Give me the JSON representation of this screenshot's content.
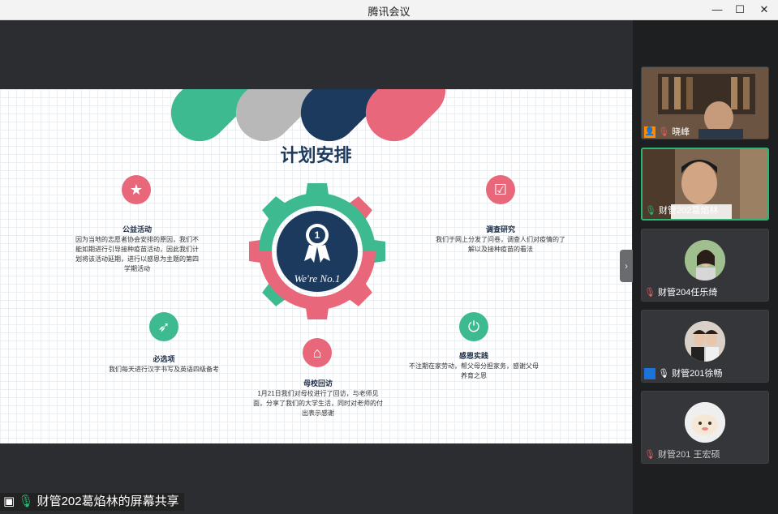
{
  "window": {
    "title": "腾讯会议",
    "min": "—",
    "max": "☐",
    "close": "✕"
  },
  "slide": {
    "title": "计划安排",
    "badge_number": "1",
    "badge_text": "We're No.1",
    "items": [
      {
        "title": "公益活动",
        "desc": "因为当地的志愿者协会安排的原因，我们不能如期进行引导接种疫苗活动，因此我们计划将该活动延期，进行以感恩为主题的第四学期活动",
        "icon": "star-icon"
      },
      {
        "title": "调查研究",
        "desc": "我们于网上分发了问卷，调查人们对疫情的了解以及接种疫苗的看法",
        "icon": "check-icon"
      },
      {
        "title": "必选项",
        "desc": "我们每天进行汉字书写及英语四级备考",
        "icon": "rocket-icon"
      },
      {
        "title": "母校回访",
        "desc": "1月21日我们对母校进行了回访，与老师见面，分享了我们的大学生活，同时对老师的付出表示感谢",
        "icon": "home-icon"
      },
      {
        "title": "感恩实践",
        "desc": "不注期在家劳动，帮父母分担家务，感谢父母养育之恩",
        "icon": "power-icon"
      }
    ],
    "colors": {
      "green": "#3dba8f",
      "grey": "#b8b8b8",
      "navy": "#1c3a5e",
      "pink": "#e8677a"
    }
  },
  "share_banner": "财管202葛焰林的屏幕共享",
  "participants": [
    {
      "name": "晓峰",
      "muted": true,
      "host": true
    },
    {
      "name": "财管202葛焰林",
      "muted": false,
      "active": true
    },
    {
      "name": "财管204任乐绮",
      "muted": true
    },
    {
      "name": "财管201徐畅",
      "muted": false,
      "host": true
    },
    {
      "name": "财管201 王宏硕",
      "muted": true
    }
  ]
}
